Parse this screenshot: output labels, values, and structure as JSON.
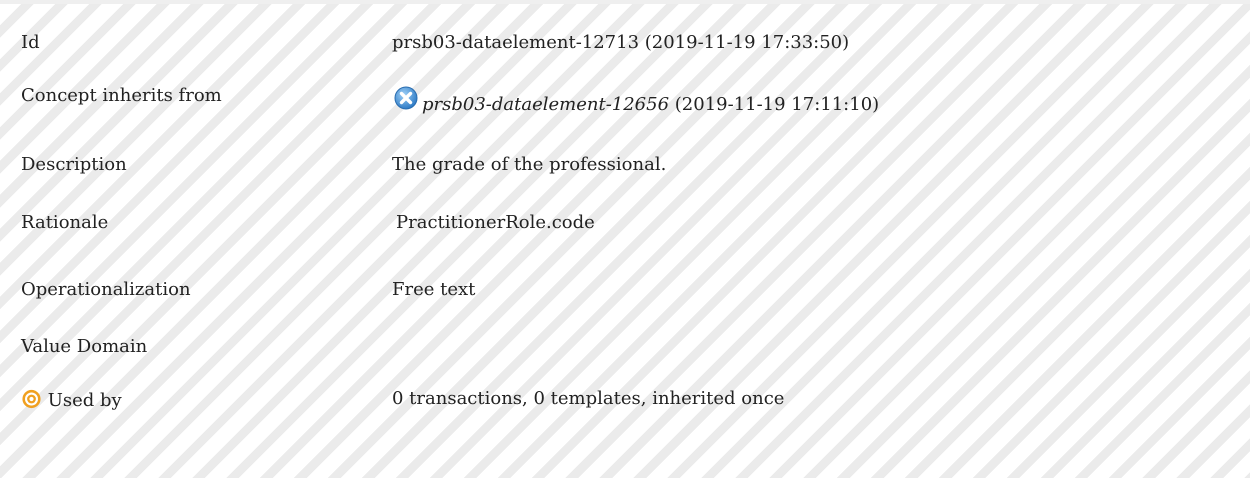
{
  "fields": {
    "id": {
      "label": "Id",
      "value": "prsb03-dataelement-12713 (2019-11-19 17:33:50)"
    },
    "inherits": {
      "label": "Concept inherits from",
      "link": "prsb03-dataelement-12656",
      "date": "(2019-11-19 17:11:10)",
      "icon": "remove-x-icon",
      "icon_color": "#3f8fd6"
    },
    "description": {
      "label": "Description",
      "value": "The grade of the professional."
    },
    "rationale": {
      "label": "Rationale",
      "value": "PractitionerRole.code"
    },
    "operationalization": {
      "label": "Operationalization",
      "value": "Free text"
    },
    "value_domain": {
      "label": "Value Domain",
      "value": ""
    },
    "used_by": {
      "label": "Used by",
      "value": "0 transactions, 0 templates, inherited once",
      "icon": "target-icon",
      "icon_color": "#f0a020"
    }
  }
}
